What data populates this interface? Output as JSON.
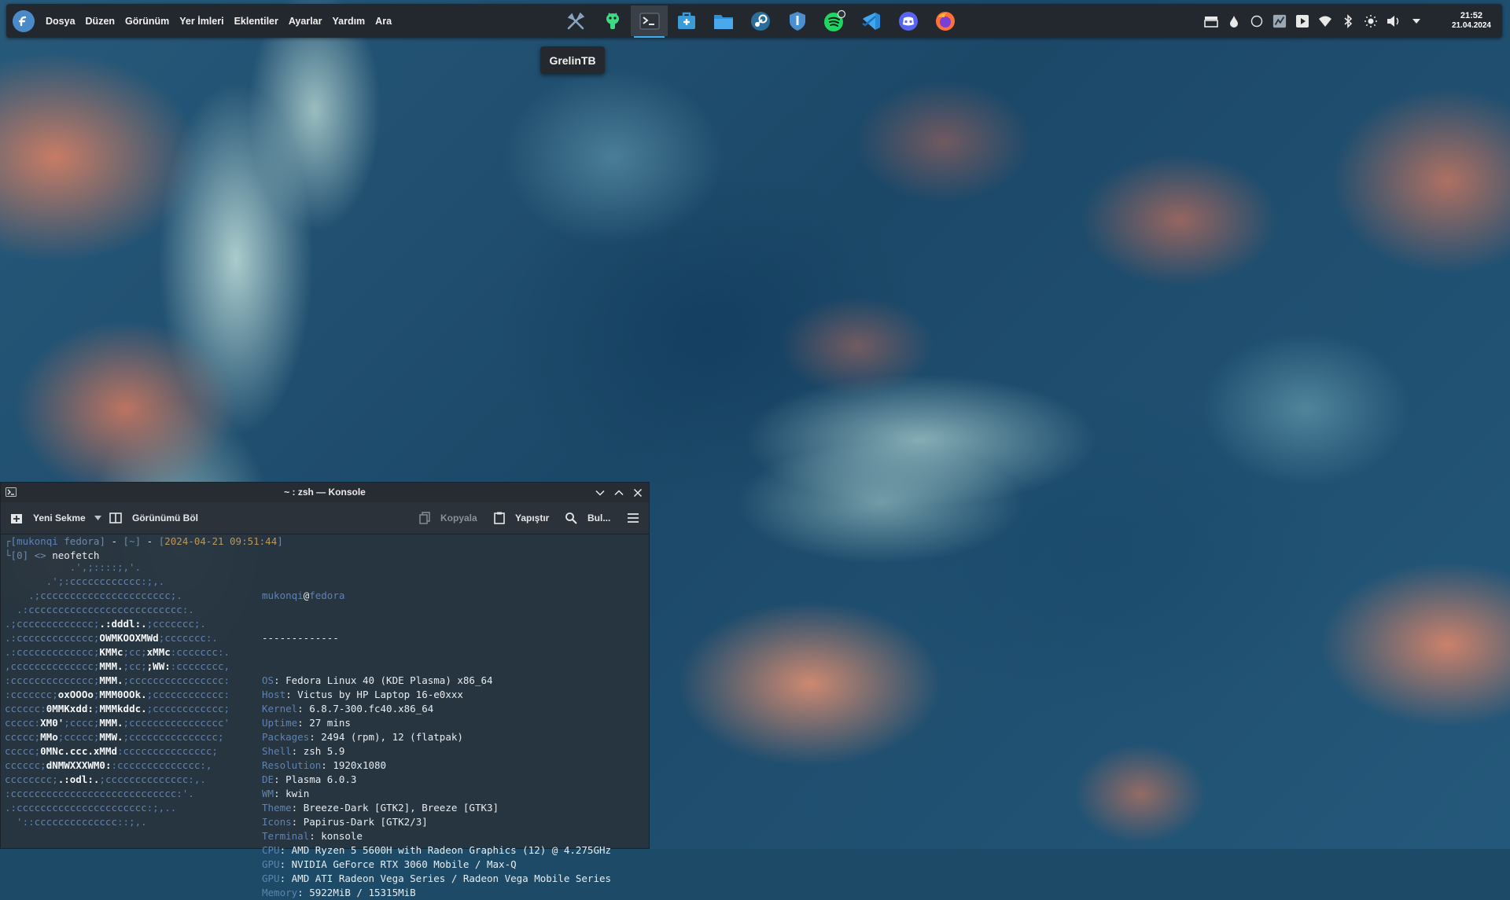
{
  "panel": {
    "menu": [
      "Dosya",
      "Düzen",
      "Görünüm",
      "Yer İmleri",
      "Eklentiler",
      "Ayarlar",
      "Yardım",
      "Ara"
    ],
    "apps": [
      "tools-icon",
      "android-icon",
      "konsole-icon",
      "store-icon",
      "folder-icon",
      "steam-icon",
      "shield-icon",
      "spotify-icon",
      "vscode-icon",
      "discord-icon",
      "firefox-icon"
    ],
    "tooltip": "GrelinTB",
    "clock": {
      "time": "21:52",
      "date": "21.04.2024"
    }
  },
  "konsole": {
    "title": "~ : zsh — Konsole",
    "toolbar": {
      "new_tab": "Yeni Sekme",
      "split": "Görünümü Böl",
      "copy": "Kopyala",
      "paste": "Yapıştır",
      "find": "Bul..."
    },
    "prompt": {
      "user": "mukonqi",
      "host": "fedora",
      "dir": "~",
      "datetime": "2024-04-21 09:51:44",
      "status": "0",
      "command": "neofetch"
    },
    "neofetch": {
      "header_user": "mukonqi",
      "header_host": "fedora",
      "separator": "-------------",
      "art": [
        "           .',;::::;,'.",
        "       .';:cccccccccccc:;,.",
        "    .;cccccccccccccccccccccc;.",
        "  .:cccccccccccccccccccccccccc:.",
        ".;ccccccccccccc;[[.:dddl:.]];ccccccc;.",
        ".:ccccccccccccc;[[OWMKOOXMWd]];ccccccc:.",
        ".:ccccccccccccc;[[KMMc]];cc;[[xMMc]]:ccccccc:.",
        ",cccccccccccccc;[[MMM.]];cc;[[;WW:]]:cccccccc,",
        ":cccccccccccccc;[[MMM.]];cccccccccccccccc:",
        ":ccccccc;[[oxOOOo]];[[MMM0OOk.]];cccccccccccc:",
        "cccccc:[[0MMKxdd:]];[[MMMkddc.]];cccccccccccc;",
        "ccccc:[[XM0']];cccc;[[MMM.]];cccccccccccccccc'",
        "ccccc;[[MMo]];ccccc;[[MMW.]];ccccccccccccccc;",
        "ccccc;[[0MNc.ccc.xMMd]]:ccccccccccccccc;",
        "cccccc;[[dNMWXXXWM0:]]:cccccccccccccc:,",
        "cccccccc;[[.:odl:.]];cccccccccccccc:,.",
        ":cccccccccccccccccccccccccccc:'.",
        ".:cccccccccccccccccccccc:;,..",
        "  '::cccccccccccccc::;,."
      ],
      "info": [
        {
          "key": "OS",
          "value": "Fedora Linux 40 (KDE Plasma) x86_64"
        },
        {
          "key": "Host",
          "value": "Victus by HP Laptop 16-e0xxx"
        },
        {
          "key": "Kernel",
          "value": "6.8.7-300.fc40.x86_64"
        },
        {
          "key": "Uptime",
          "value": "27 mins"
        },
        {
          "key": "Packages",
          "value": "2494 (rpm), 12 (flatpak)"
        },
        {
          "key": "Shell",
          "value": "zsh 5.9"
        },
        {
          "key": "Resolution",
          "value": "1920x1080"
        },
        {
          "key": "DE",
          "value": "Plasma 6.0.3"
        },
        {
          "key": "WM",
          "value": "kwin"
        },
        {
          "key": "Theme",
          "value": "Breeze-Dark [GTK2], Breeze [GTK3]"
        },
        {
          "key": "Icons",
          "value": "Papirus-Dark [GTK2/3]"
        },
        {
          "key": "Terminal",
          "value": "konsole"
        },
        {
          "key": "CPU",
          "value": "AMD Ryzen 5 5600H with Radeon Graphics (12) @ 4.275GHz"
        },
        {
          "key": "GPU",
          "value": "NVIDIA GeForce RTX 3060 Mobile / Max-Q"
        },
        {
          "key": "GPU",
          "value": "AMD ATI Radeon Vega Series / Radeon Vega Mobile Series"
        },
        {
          "key": "Memory",
          "value": "5922MiB / 15315MiB"
        }
      ]
    }
  },
  "colors": {
    "panel_bg": "#23282e",
    "accent": "#3daee9",
    "fedora_blue": "#5e82b4",
    "date_color": "#b9975e"
  }
}
